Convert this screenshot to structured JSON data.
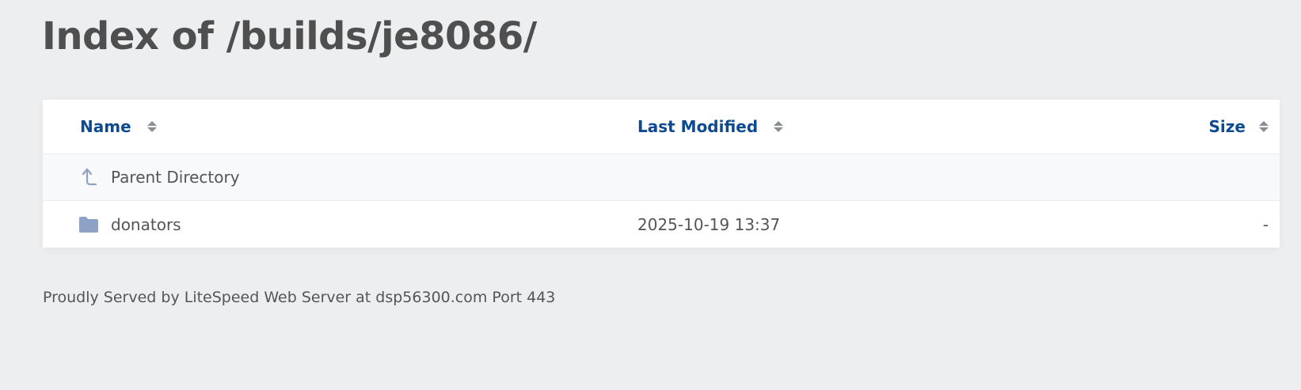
{
  "page": {
    "title": "Index of /builds/je8086/"
  },
  "table": {
    "headers": {
      "name": "Name",
      "last_modified": "Last Modified",
      "size": "Size"
    },
    "parent": {
      "label": "Parent Directory",
      "icon": "arrow-up-icon"
    },
    "rows": [
      {
        "name": "donators",
        "icon": "folder-icon",
        "last_modified": "2025-10-19 13:37",
        "size": "-"
      }
    ]
  },
  "colors": {
    "background": "#eceef0",
    "link": "#0e4a8f",
    "icon": "#8da2c4"
  },
  "footer": {
    "text": "Proudly Served by LiteSpeed Web Server at dsp56300.com Port 443"
  }
}
